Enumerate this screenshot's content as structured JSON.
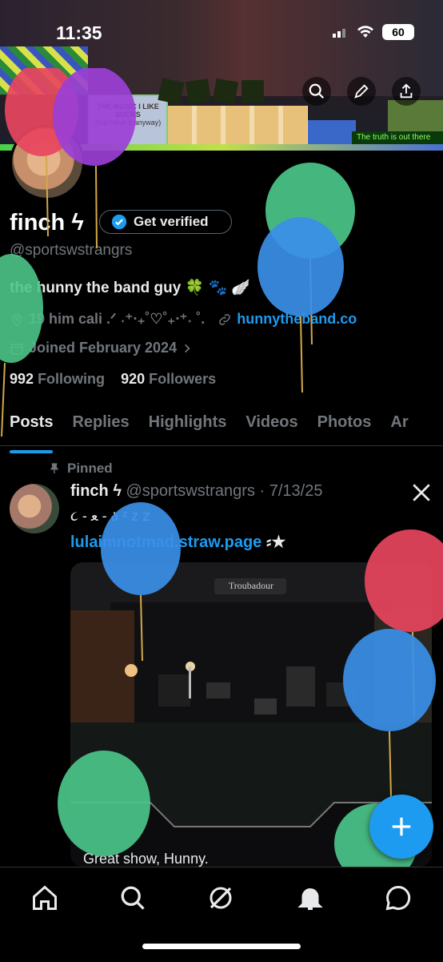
{
  "status_bar": {
    "time": "11:35",
    "battery": "60"
  },
  "banner": {
    "sign_text": "THE MUSIC I LIKE SUCKS",
    "sign_subtext": "(but I love it anyway)",
    "ticker_text": "The truth is out there"
  },
  "profile": {
    "display_name": "finch ϟ",
    "verify_label": "Get verified",
    "handle": "@sportswstrangrs",
    "bio": "the hunny the band guy 🍀 🐾 🪽 ",
    "location": "19 him cali .ᐟ ˖⁺‧₊˚♡˚₊‧⁺˖ ˚.",
    "website": "hunnytheband.co",
    "joined": "Joined February 2024",
    "following_count": "992",
    "following_label": "Following",
    "followers_count": "920",
    "followers_label": "Followers"
  },
  "tabs": [
    "Posts",
    "Replies",
    "Highlights",
    "Videos",
    "Photos",
    "Ar"
  ],
  "pinned_post": {
    "pinned_label": "Pinned",
    "author": "finch ϟ",
    "handle": "@sportswstrangrs",
    "date": "· 7/13/25",
    "line2": "૮ - ﻌ - ა ᶻ z 𝗓",
    "link": "lulaimnotmad.straw.page",
    "link_suffix": " ⸗★",
    "venue_sign": "Troubadour",
    "caption": "Great show, Hunny."
  },
  "colors": {
    "accent": "#1d9bf0",
    "muted": "#71767b",
    "text": "#e7e9ea",
    "border": "#2f3336"
  },
  "icons": [
    "back-icon",
    "search-icon",
    "edit-icon",
    "share-icon",
    "verified-badge-icon",
    "location-icon",
    "link-icon",
    "calendar-icon",
    "chevron-right-icon",
    "pin-icon",
    "x-logo-icon",
    "plus-icon",
    "home-icon",
    "search-icon",
    "grok-icon",
    "bell-icon",
    "messages-icon"
  ]
}
